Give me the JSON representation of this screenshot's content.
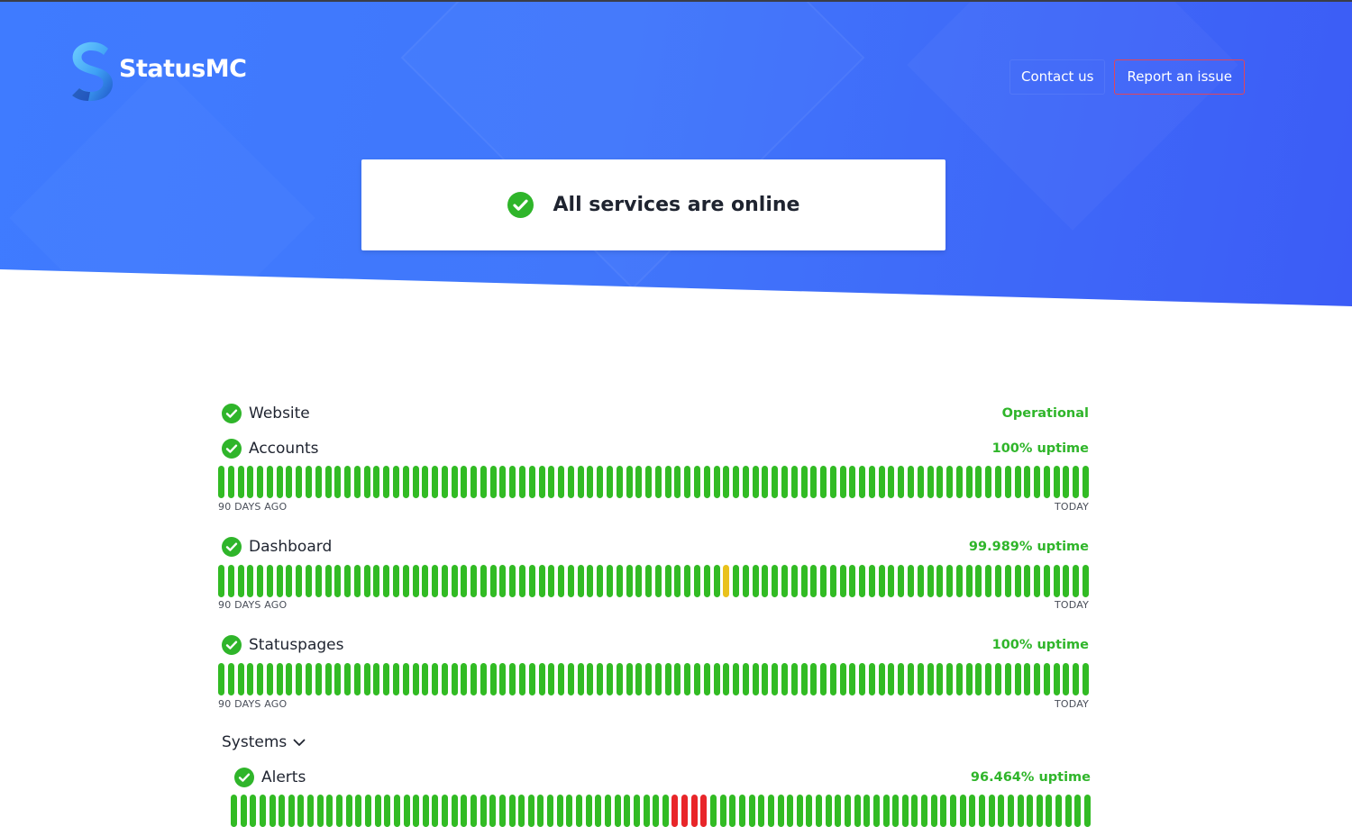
{
  "brand": {
    "name": "StatusMC",
    "colors": {
      "hero_start": "#3f7bff",
      "hero_end": "#3c5cf6",
      "operational": "#32bb24",
      "degraded": "#e9c21c",
      "outage": "#e8262a",
      "report_border": "#e2455b"
    }
  },
  "nav": {
    "contact_label": "Contact us",
    "report_label": "Report an issue"
  },
  "overall": {
    "icon": "check-circle-icon",
    "text": "All services are online"
  },
  "labels": {
    "start": "90 DAYS AGO",
    "end": "TODAY"
  },
  "components": [
    {
      "name": "Website",
      "status_text": "Operational",
      "has_history": false
    },
    {
      "name": "Accounts",
      "status_text": "100% uptime",
      "has_history": true,
      "days": 90,
      "warn_days": [],
      "down_days": []
    },
    {
      "name": "Dashboard",
      "status_text": "99.989% uptime",
      "has_history": true,
      "days": 90,
      "warn_days": [
        52
      ],
      "down_days": []
    },
    {
      "name": "Statuspages",
      "status_text": "100% uptime",
      "has_history": true,
      "days": 90,
      "warn_days": [],
      "down_days": []
    }
  ],
  "groups": [
    {
      "name": "Systems",
      "expanded": true,
      "toggle_icon": "chevron-down-icon",
      "components": [
        {
          "name": "Alerts",
          "status_text": "96.464% uptime",
          "has_history": true,
          "days": 90,
          "warn_days": [],
          "down_days": [
            46,
            47,
            48,
            49
          ]
        }
      ]
    }
  ]
}
